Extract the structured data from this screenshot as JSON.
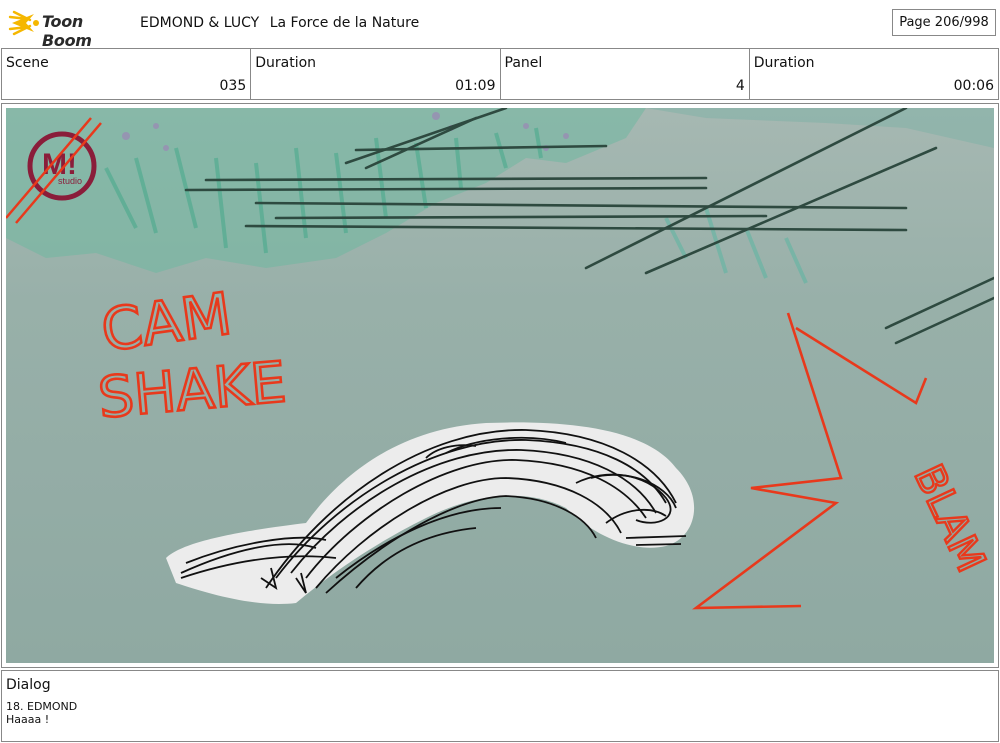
{
  "header": {
    "brand": "Toon Boom",
    "project": "EDMOND & LUCY",
    "episode": "La Force de la Nature",
    "page": "Page 206/998"
  },
  "info": {
    "scene_label": "Scene",
    "scene_value": "035",
    "duration_label": "Duration",
    "duration_value": "01:09",
    "panel_label": "Panel",
    "panel_value": "4",
    "panel_duration_label": "Duration",
    "panel_duration_value": "00:06"
  },
  "panel": {
    "studio_logo_mark": "M!",
    "studio_logo_sub": "studio",
    "annotation_1": "CAM",
    "annotation_2": "SHAKE",
    "sfx": "BLAM",
    "colors": {
      "sfx_red": "#e8391c",
      "background": "#93ada6",
      "foliage": "#5fc0a4"
    }
  },
  "dialog": {
    "label": "Dialog",
    "speaker_line": "18. EDMOND",
    "text": "Haaaa !"
  }
}
